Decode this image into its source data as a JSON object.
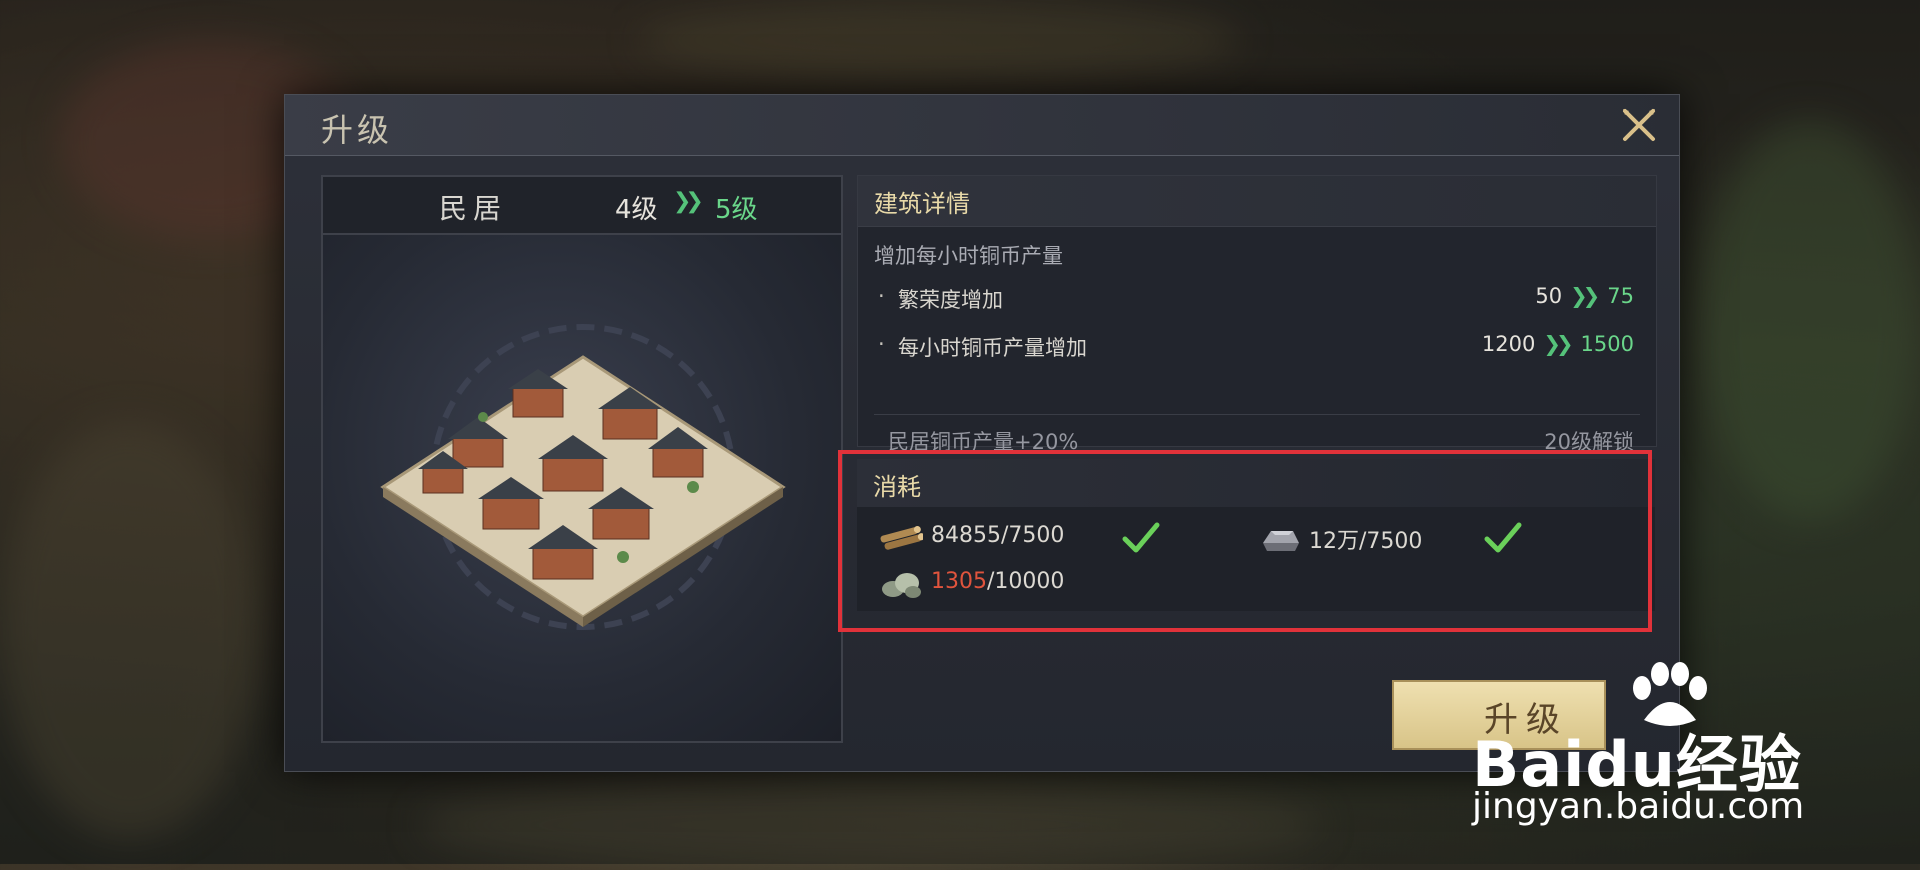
{
  "dialog": {
    "title": "升级"
  },
  "building": {
    "name": "民居",
    "current_level": "4级",
    "next_level": "5级"
  },
  "details": {
    "title": "建筑详情",
    "description": "增加每小时铜币产量",
    "stats": [
      {
        "label": "繁荣度增加",
        "from": "50",
        "to": "75"
      },
      {
        "label": "每小时铜币产量增加",
        "from": "1200",
        "to": "1500"
      }
    ],
    "locked_bonus": {
      "label": "民居铜币产量+20%",
      "requirement": "20级解锁"
    }
  },
  "cost": {
    "title": "消耗",
    "items": [
      {
        "icon": "wood-logs-icon",
        "have": "84855",
        "need": "/7500",
        "sufficient": true
      },
      {
        "icon": "iron-ingot-icon",
        "have": "12万",
        "need": "/7500",
        "sufficient": true
      },
      {
        "icon": "stone-icon",
        "have": "1305",
        "need": "/10000",
        "sufficient": false
      }
    ]
  },
  "buttons": {
    "upgrade": "升级"
  },
  "watermark": {
    "brand": "Baidu经验",
    "url": "jingyan.baidu.com"
  },
  "colors": {
    "accent_green": "#6ad68a",
    "insufficient_red": "#e0543d",
    "highlight_box": "#e1323a",
    "section_title": "#e8d9a8"
  }
}
